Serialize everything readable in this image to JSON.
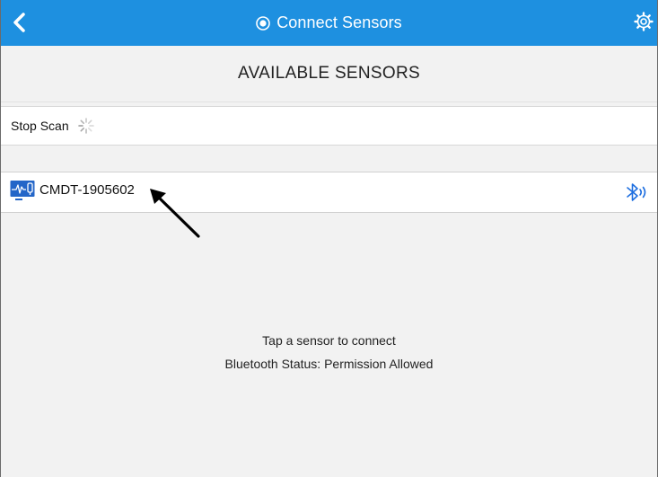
{
  "header": {
    "title": "Connect Sensors",
    "back_icon": "chevron-left-icon",
    "title_icon": "target-icon",
    "settings_icon": "gear-icon",
    "bar_color": "#1e90e0"
  },
  "section": {
    "title": "AVAILABLE SENSORS"
  },
  "scan": {
    "label": "Stop Scan",
    "icon": "spinner-icon"
  },
  "sensors": [
    {
      "name": "CMDT-1905602",
      "icon": "sensor-waveform-icon",
      "status_icon": "bluetooth-signal-icon"
    }
  ],
  "info": {
    "hint": "Tap a sensor to connect",
    "bluetooth_status": "Bluetooth Status: Permission Allowed"
  },
  "colors": {
    "accent": "#1e90e0",
    "background": "#f2f2f2",
    "row_background": "#ffffff"
  }
}
